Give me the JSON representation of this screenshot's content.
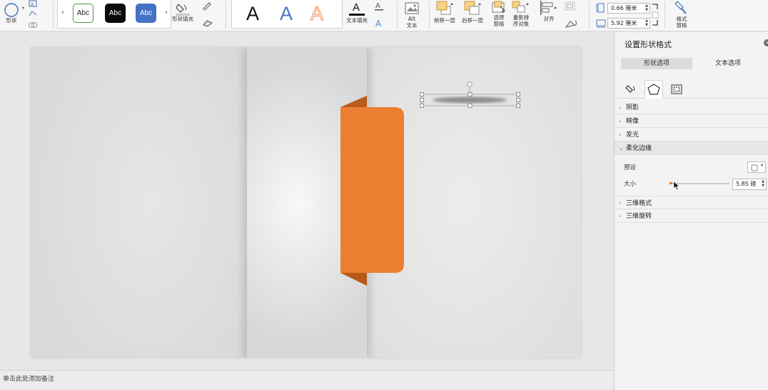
{
  "ribbon": {
    "shapes_label": "形状",
    "style_left_arrow": "‹",
    "style_right_arrow": "›",
    "shape_styles": [
      "Abc",
      "Abc",
      "Abc"
    ],
    "shape_fill_label": "形状填充",
    "wordart": [
      "A",
      "A",
      "A"
    ],
    "text_fill_label": "文本填充",
    "alt_text_label_1": "Alt",
    "alt_text_label_2": "文本",
    "bring_forward_label": "前移一层",
    "send_backward_label": "后移一层",
    "selection_pane_label_1": "选择",
    "selection_pane_label_2": "窗格",
    "reorder_label_1": "重新排",
    "reorder_label_2": "序对象",
    "align_label": "对齐",
    "height_value": "0.66 厘米",
    "width_value": "5.92 厘米",
    "format_pane_label_1": "格式",
    "format_pane_label_2": "窗格",
    "colors": {
      "style1_border": "#4a9a3a",
      "style2_fill": "#0a0a0a",
      "style3_fill": "#4472c4",
      "wordart_blue": "#4a74c8",
      "wordart_orange": "#f0a070"
    }
  },
  "slide": {
    "tab_color": "#eb7e30",
    "tab_fold_color": "#b85a1a"
  },
  "notes_placeholder": "单击此处添加备注",
  "pane": {
    "title": "设置形状格式",
    "tab_shape": "形状选项",
    "tab_text": "文本选项",
    "sections": {
      "shadow": "阴影",
      "reflection": "映像",
      "glow": "发光",
      "soft_edges": "柔化边缘",
      "format_3d": "三维格式",
      "rotation_3d": "三维旋转"
    },
    "preset_label": "预设",
    "size_label": "大小",
    "size_value": "5.85 磅",
    "size_level": 0.02
  }
}
